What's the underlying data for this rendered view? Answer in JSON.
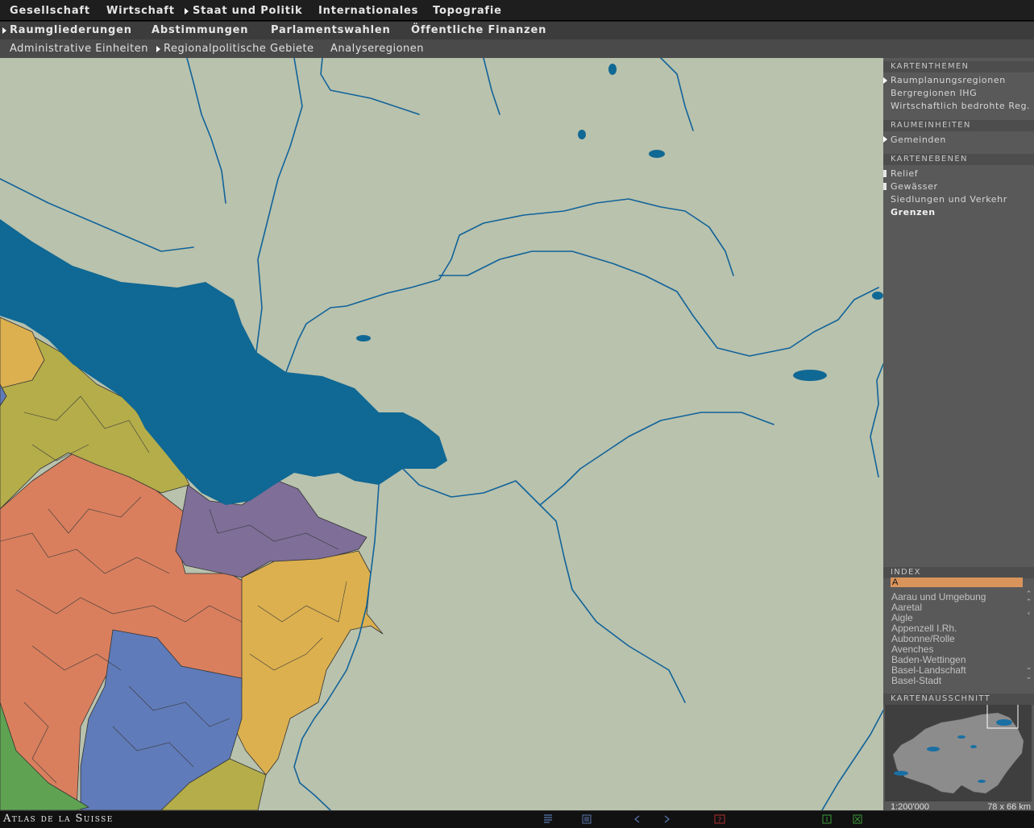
{
  "menu_top": [
    "Gesellschaft",
    "Wirtschaft",
    "Staat und Politik",
    "Internationales",
    "Topografie"
  ],
  "menu_second": [
    "Raumgliederungen",
    "Abstimmungen",
    "Parlamentswahlen",
    "Öffentliche Finanzen"
  ],
  "menu_third": [
    "Administrative Einheiten",
    "Regionalpolitische Gebiete",
    "Analyseregionen"
  ],
  "sidebar": {
    "kartenthemen": {
      "title": "KARTENTHEMEN",
      "items": [
        "Raumplanungsregionen",
        "Bergregionen IHG",
        "Wirtschaftlich bedrohte Reg."
      ],
      "selected": "Raumplanungsregionen"
    },
    "raumeinheiten": {
      "title": "RAUMEINHEITEN",
      "items": [
        "Gemeinden"
      ]
    },
    "kartenebenen": {
      "title": "KARTENEBENEN",
      "items": [
        "Relief",
        "Gewässer",
        "Siedlungen und Verkehr",
        "Grenzen"
      ]
    },
    "index": {
      "title": "INDEX",
      "search_value": "A",
      "items": [
        "Aarau und Umgebung",
        "Aaretal",
        "Aigle",
        "Appenzell I.Rh.",
        "Aubonne/Rolle",
        "Avenches",
        "Baden-Wettingen",
        "Basel-Landschaft",
        "Basel-Stadt"
      ]
    },
    "kartenausschnitt": {
      "title": "KARTENAUSSCHNITT",
      "scale": "1:200'000",
      "extent": "78 x 66 km"
    }
  },
  "footer": {
    "brand": "Atlas de la Suisse"
  },
  "colors": {
    "lake": "#106894",
    "river": "#11639a",
    "terrain": "#b9c2ac",
    "region_orange": "#d97f5e",
    "region_olive": "#b4ad4a",
    "region_yellow": "#dcb04f",
    "region_purple": "#7e6e98",
    "region_blue": "#5f7bb9",
    "region_green": "#5fa352",
    "index_highlight": "#d9945c"
  }
}
